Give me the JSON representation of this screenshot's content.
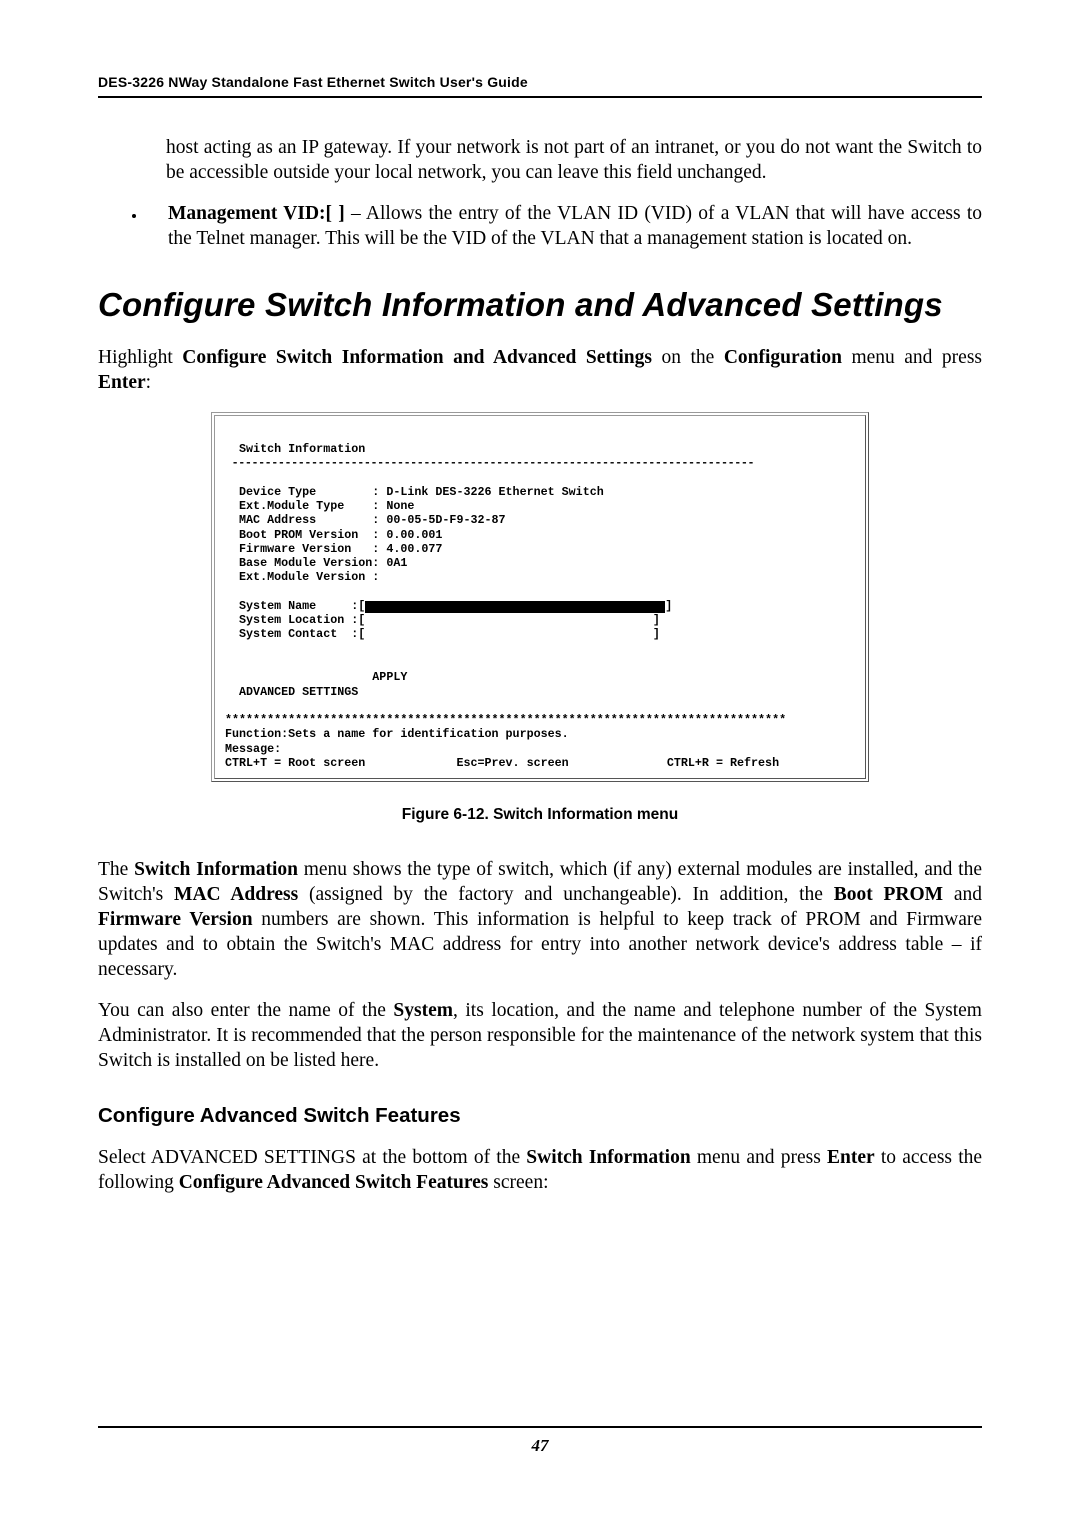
{
  "header": {
    "title": "DES-3226 NWay Standalone Fast Ethernet Switch User's Guide"
  },
  "para1": "host acting as an IP gateway. If your network is not part of an intranet, or you do not want the Switch to be accessible outside your local network, you can leave this field unchanged.",
  "bullet1": {
    "strong": "Management VID:[   ]",
    "rest": " – Allows the entry of the VLAN ID (VID) of a VLAN that will have access to the Telnet manager. This will be the VID of the VLAN that a management station is located on."
  },
  "section_title": "Configure Switch Information and Advanced Settings",
  "para2a": "Highlight ",
  "para2b": "Configure Switch Information and Advanced Settings",
  "para2c": " on the ",
  "para2d": "Configuration",
  "para2e": " menu and press ",
  "para2f": "Enter",
  "para2g": ":",
  "term": {
    "title": "  Switch Information",
    "dash": " -------------------------------------------------------------------------------",
    "l1": "  Device Type        : D-Link DES-3226 Ethernet Switch",
    "l2": "  Ext.Module Type    : None",
    "l3": "  MAC Address        : 00-05-5D-F9-32-87",
    "l4": "  Boot PROM Version  : 0.00.001",
    "l5": "  Firmware Version   : 4.00.077",
    "l6": "  Base Module Version: 0A1",
    "l7": "  Ext.Module Version :",
    "l8a": "  System Name     :[",
    "l8b": "]",
    "l9": "  System Location :[                                         ]",
    "l10": "  System Contact  :[                                         ]",
    "l11": "                     APPLY",
    "l12": "  ADVANCED SETTINGS",
    "stars": "********************************************************************************",
    "f1": "Function:Sets a name for identification purposes.",
    "f2": "Message:",
    "f3": "CTRL+T = Root screen             Esc=Prev. screen              CTRL+R = Refresh"
  },
  "figcap": "Figure 6-12.  Switch Information menu",
  "para3": {
    "a": "The ",
    "b": "Switch Information",
    "c": " menu shows the type of switch, which (if any) external modules are installed, and the Switch's ",
    "d": "MAC Address",
    "e": " (assigned by the factory and unchangeable). In addition, the ",
    "f": "Boot PROM",
    "g": " and ",
    "h": "Firmware Version",
    "i": " numbers are shown. This information is helpful to keep track of PROM and Firmware updates and to obtain the Switch's MAC address for entry into another network device's address table – if necessary."
  },
  "para4": {
    "a": "You can also enter the name of the ",
    "b": "System",
    "c": ", its location, and the name and telephone number of the System Administrator. It is recommended that the person responsible for the maintenance of the network system that this Switch is installed on be listed here."
  },
  "sub_title": "Configure Advanced Switch Features",
  "para5": {
    "a": "Select ADVANCED SETTINGS at the bottom of the ",
    "b": "Switch Information",
    "c": " menu and press ",
    "d": "Enter",
    "e": " to access the following ",
    "f": "Configure Advanced Switch Features",
    "g": " screen:"
  },
  "pagenum": "47"
}
